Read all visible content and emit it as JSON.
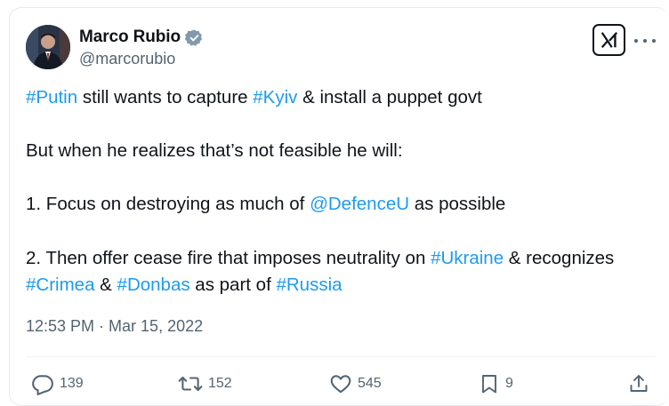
{
  "author": {
    "name": "Marco Rubio",
    "handle": "@marcorubio",
    "verified": true,
    "avatar_icon": "profile-photo"
  },
  "post": {
    "lines": [
      [
        {
          "text": "#Putin",
          "link": true
        },
        {
          "text": " still wants to capture ",
          "link": false
        },
        {
          "text": "#Kyiv",
          "link": true
        },
        {
          "text": " & install a puppet govt",
          "link": false
        }
      ],
      [
        {
          "text": "But when he realizes that’s not feasible he will:",
          "link": false
        }
      ],
      [
        {
          "text": "1. Focus on destroying as much of ",
          "link": false
        },
        {
          "text": "@DefenceU",
          "link": true
        },
        {
          "text": " as possible",
          "link": false
        }
      ],
      [
        {
          "text": "2. Then offer cease fire that imposes neutrality on ",
          "link": false
        },
        {
          "text": "#Ukraine",
          "link": true
        },
        {
          "text": " & recognizes",
          "link": false
        }
      ],
      [
        {
          "text": "#Crimea",
          "link": true
        },
        {
          "text": " & ",
          "link": false
        },
        {
          "text": "#Donbas",
          "link": true
        },
        {
          "text": " as part of ",
          "link": false
        },
        {
          "text": "#Russia",
          "link": true
        }
      ]
    ],
    "timestamp": "12:53 PM · Mar 15, 2022"
  },
  "actions": {
    "replies": "139",
    "reposts": "152",
    "likes": "545",
    "bookmarks": "9"
  },
  "icons": {
    "platform_logo": "x-logo-icon",
    "more": "more-icon",
    "reply": "reply-icon",
    "repost": "repost-icon",
    "like": "heart-icon",
    "bookmark": "bookmark-icon",
    "share": "share-icon"
  },
  "colors": {
    "link": "#1d9bf0",
    "text": "#0f1419",
    "secondary": "#536471",
    "verified": "#829aab"
  }
}
